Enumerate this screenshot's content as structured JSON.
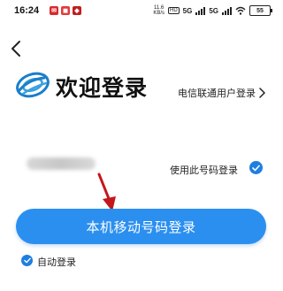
{
  "status_bar": {
    "time": "16:24",
    "app_icons": [
      {
        "name": "notification-app-icon-1",
        "color": "#d9292b",
        "glyph": "✉"
      },
      {
        "name": "notification-app-icon-2",
        "color": "#d9292b",
        "glyph": "◼"
      },
      {
        "name": "notification-app-icon-3",
        "color": "#c21d1d",
        "glyph": "◆"
      }
    ],
    "speed_value": "11.6",
    "speed_unit": "KB/s",
    "network_1": "5G",
    "network_2": "5G",
    "battery": "55"
  },
  "header": {
    "welcome_text": "欢迎登录",
    "telecom_link": "电信联通用户登录"
  },
  "login": {
    "use_number_label": "使用此号码登录",
    "login_button": "本机移动号码登录",
    "auto_login_label": "自动登录"
  },
  "colors": {
    "primary": "#2b8ff0",
    "check": "#1e7fe0",
    "arrow": "#c4161c",
    "logo": "#1a7fc9"
  }
}
